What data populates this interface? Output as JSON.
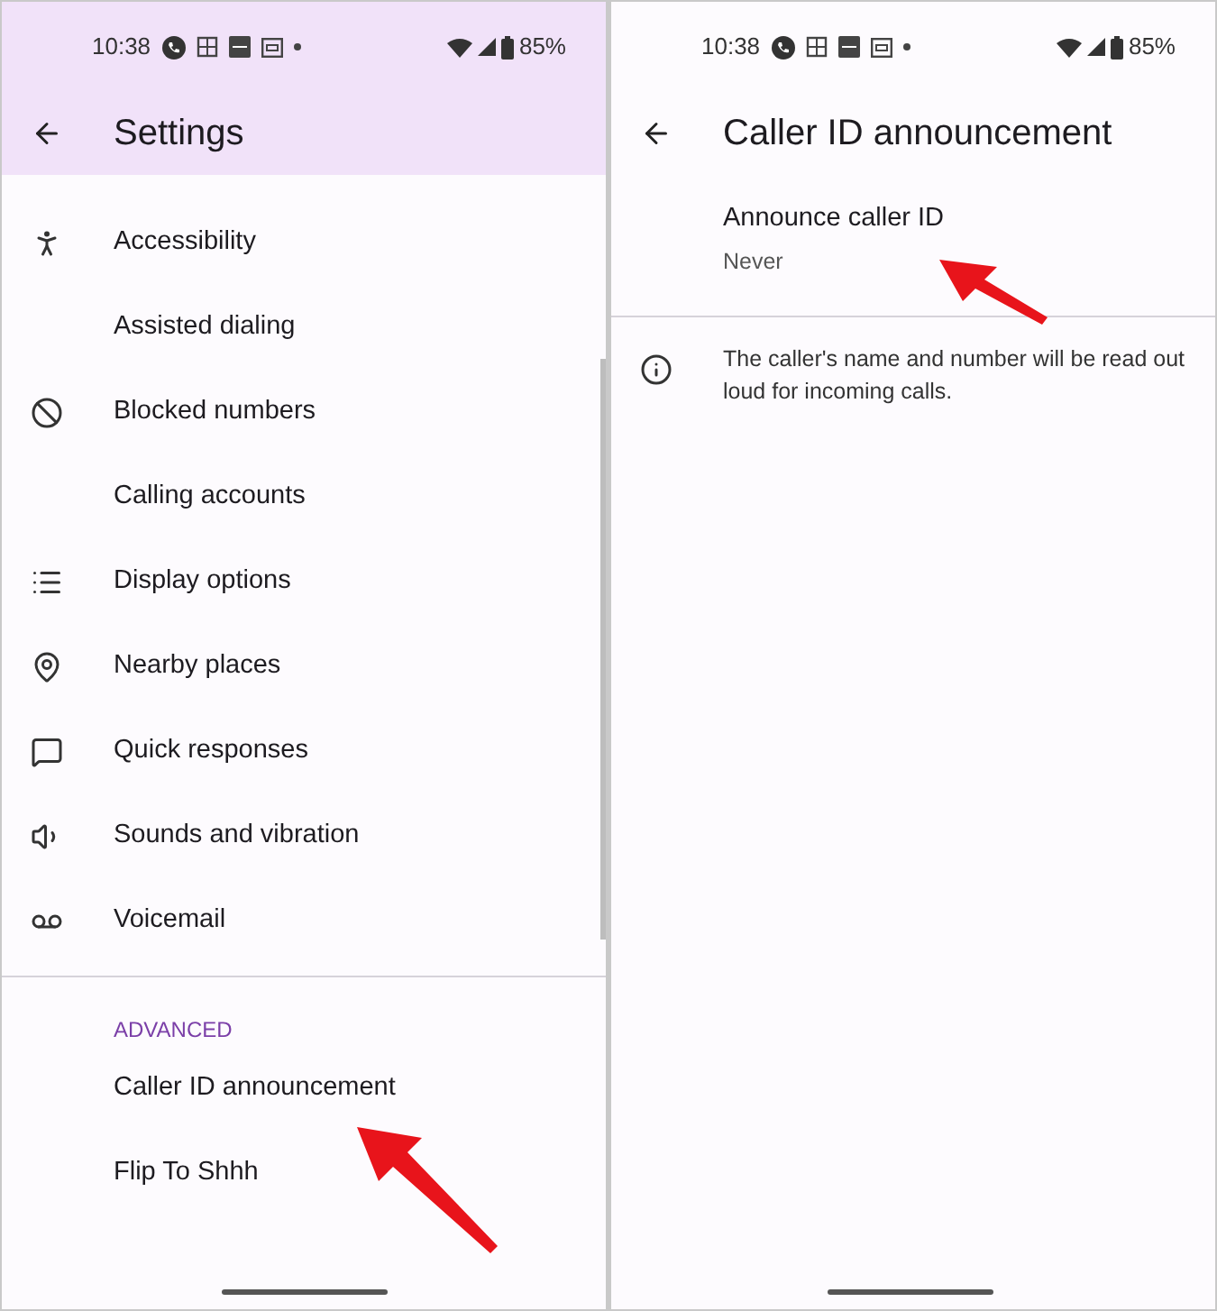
{
  "left_screen": {
    "status_bar": {
      "time": "10:38",
      "battery": "85%"
    },
    "title": "Settings",
    "general_items": [
      {
        "label": "Accessibility"
      },
      {
        "label": "Assisted dialing"
      },
      {
        "label": "Blocked numbers"
      },
      {
        "label": "Calling accounts"
      },
      {
        "label": "Display options"
      },
      {
        "label": "Nearby places"
      },
      {
        "label": "Quick responses"
      },
      {
        "label": "Sounds and vibration"
      },
      {
        "label": "Voicemail"
      }
    ],
    "advanced_header": "ADVANCED",
    "advanced_items": [
      {
        "label": "Caller ID announcement"
      },
      {
        "label": "Flip To Shhh"
      }
    ]
  },
  "right_screen": {
    "status_bar": {
      "time": "10:38",
      "battery": "85%"
    },
    "title": "Caller ID announcement",
    "setting": {
      "title": "Announce caller ID",
      "value": "Never"
    },
    "info": "The caller's name and number will be read out loud for incoming calls."
  }
}
